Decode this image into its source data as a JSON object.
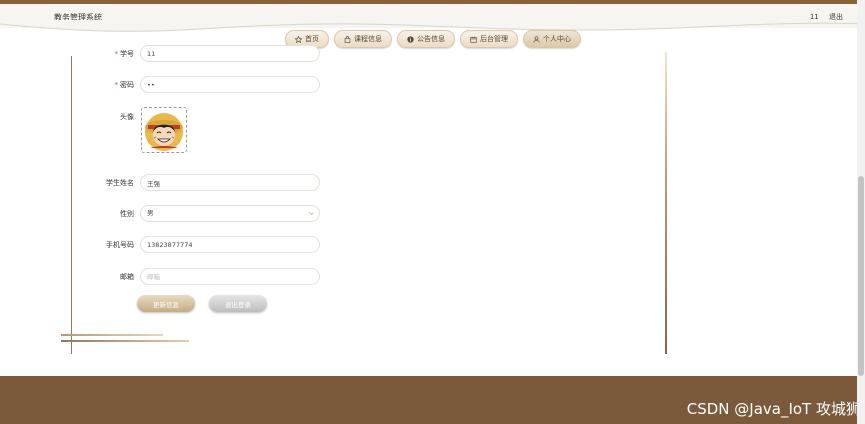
{
  "header": {
    "title": "教务管理系统",
    "username": "11",
    "logout": "退出"
  },
  "nav": [
    {
      "label": "首页",
      "icon": "star-icon"
    },
    {
      "label": "课程信息",
      "icon": "bag-icon"
    },
    {
      "label": "公告信息",
      "icon": "info-icon"
    },
    {
      "label": "后台管理",
      "icon": "calendar-icon"
    },
    {
      "label": "个人中心",
      "icon": "user-icon",
      "active": true
    }
  ],
  "form": {
    "student_id_label": "学号",
    "student_id_value": "11",
    "password_label": "密码",
    "password_value": "••",
    "avatar_label": "头像",
    "name_label": "学生姓名",
    "name_value": "王强",
    "gender_label": "性别",
    "gender_value": "男",
    "phone_label": "手机号码",
    "phone_value": "13823877774",
    "email_label": "邮箱",
    "email_placeholder": "邮箱",
    "required_mark": "*"
  },
  "buttons": {
    "update": "更新信息",
    "logout": "退出登录"
  },
  "watermark": "CSDN @Java_IoT 攻城狮",
  "colors": {
    "brand_brown": "#7a5a3a",
    "accent_gold": "#c7ab82",
    "required_red": "#e0463a"
  }
}
